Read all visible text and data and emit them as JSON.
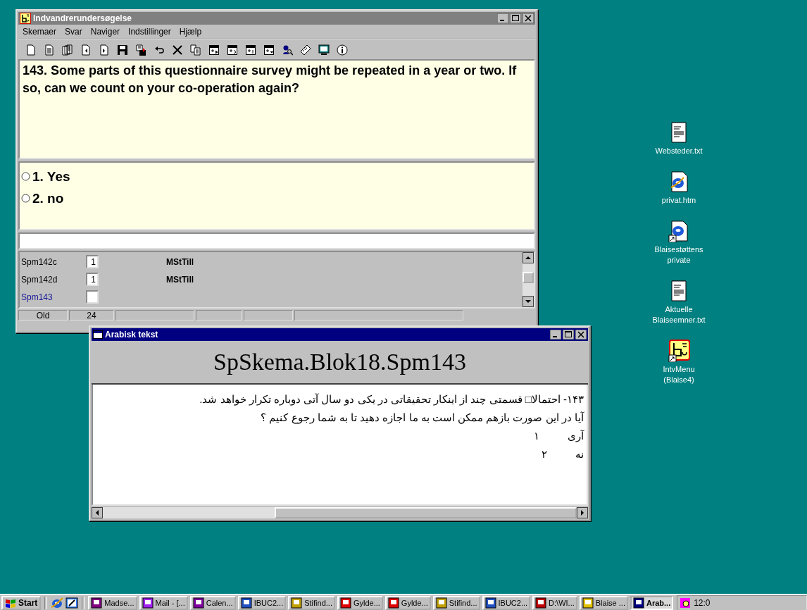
{
  "main_window": {
    "title": "Indvandrerundersøgelse",
    "menu": [
      "Skemaer",
      "Svar",
      "Naviger",
      "Indstillinger",
      "Hjælp"
    ],
    "question": "143. Some parts of this questionnaire survey might be repeated in a year or two. If so, can we count on your co-operation again?",
    "answers": [
      {
        "label": "1. Yes",
        "selected": false
      },
      {
        "label": "2. no",
        "selected": false
      }
    ],
    "fields": [
      {
        "name": "Spm142c",
        "value": "1",
        "status": "MStTill",
        "selected": false
      },
      {
        "name": "Spm142d",
        "value": "1",
        "status": "MStTill",
        "selected": false
      },
      {
        "name": "Spm143",
        "selected": true
      }
    ],
    "status_bar": [
      "Old",
      "24"
    ]
  },
  "arabic_window": {
    "title": "Arabisk tekst",
    "heading": "SpSkema.Blok18.Spm143",
    "lines": [
      "۱۴۳- احتمالا□ قسمتی چند از اینکار تحقیقاتی در یکی دو سال آتی دوباره تکرار خواهد شد.",
      "آیا در این صورت بازهم ممکن است به ما اجازه دهید تا به شما رجوع کنیم ؟"
    ],
    "options": [
      {
        "label": "آری",
        "number": "۱"
      },
      {
        "label": "نه",
        "number": "۲"
      }
    ]
  },
  "desktop_icons": [
    {
      "label": "Websteder.txt",
      "kind": "text"
    },
    {
      "label": "privat.htm",
      "kind": "web"
    },
    {
      "label": "Blaisestøttens private",
      "kind": "webshortcut"
    },
    {
      "label": "Aktuelle Blaiseemner.txt",
      "kind": "text"
    },
    {
      "label": "IntvMenu (Blaise4)",
      "kind": "blaise"
    }
  ],
  "taskbar": {
    "start": "Start",
    "tasks": [
      {
        "label": "Madse...",
        "selected": false
      },
      {
        "label": "Mail - [...",
        "selected": false
      },
      {
        "label": "Calen...",
        "selected": false
      },
      {
        "label": "IBUC2...",
        "selected": false
      },
      {
        "label": "Stifind...",
        "selected": false
      },
      {
        "label": "Gylde...",
        "selected": false
      },
      {
        "label": "Gylde...",
        "selected": false
      },
      {
        "label": "Stifind...",
        "selected": false
      },
      {
        "label": "IBUC2...",
        "selected": false
      },
      {
        "label": "D:\\WI...",
        "selected": false
      },
      {
        "label": "Blaise ...",
        "selected": false
      },
      {
        "label": "Arab...",
        "selected": true
      }
    ],
    "clock": "12:0"
  }
}
